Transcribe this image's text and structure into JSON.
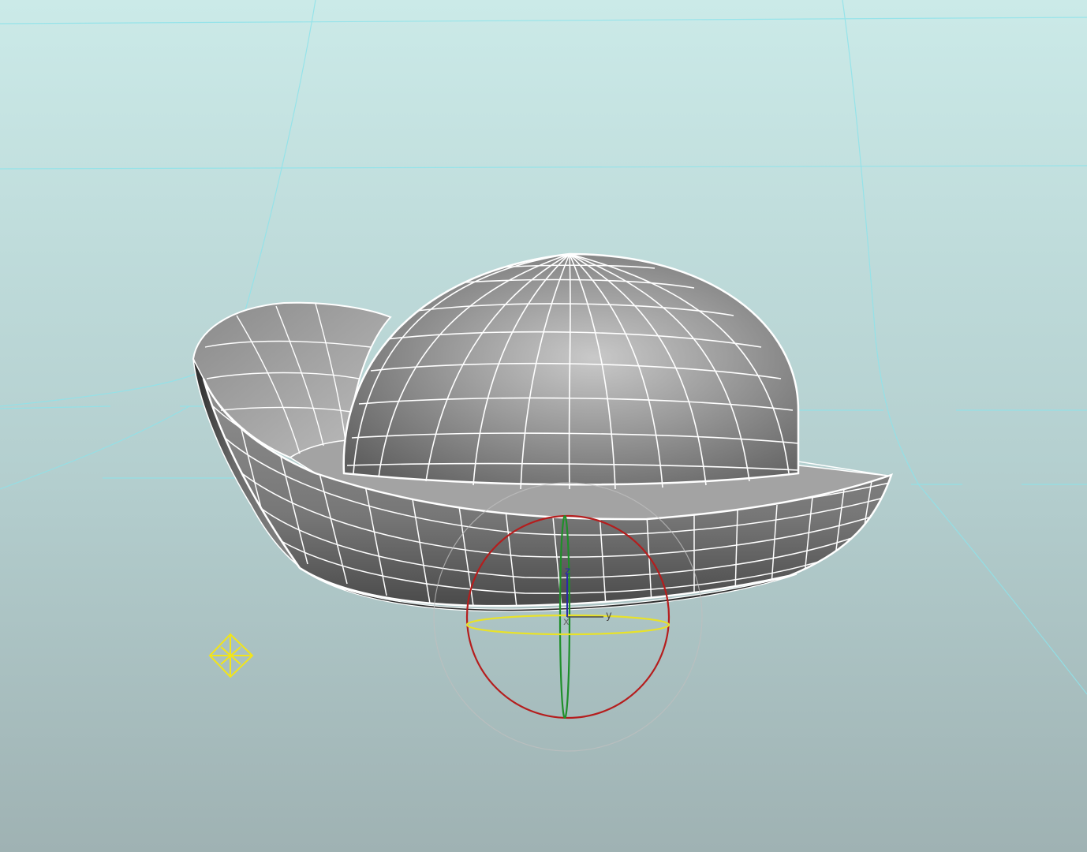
{
  "viewport": {
    "background_top": "#c9e8e6",
    "background_bottom": "#9db1b2",
    "grid_color": "#8ee3ea"
  },
  "model": {
    "fill_color": "#8a8a8a",
    "wireframe_color": "#ffffff"
  },
  "gizmo": {
    "x_ring_color": "#b51d1d",
    "y_ring_color": "#1f8f2a",
    "z_ring_color": "#e8e22a",
    "outer_ring_color": "#bfbfbf",
    "axis_labels": {
      "z": "z",
      "y": "y",
      "x": "x"
    }
  },
  "light_icon": {
    "name": "light-locator",
    "color": "#f2e51a"
  }
}
